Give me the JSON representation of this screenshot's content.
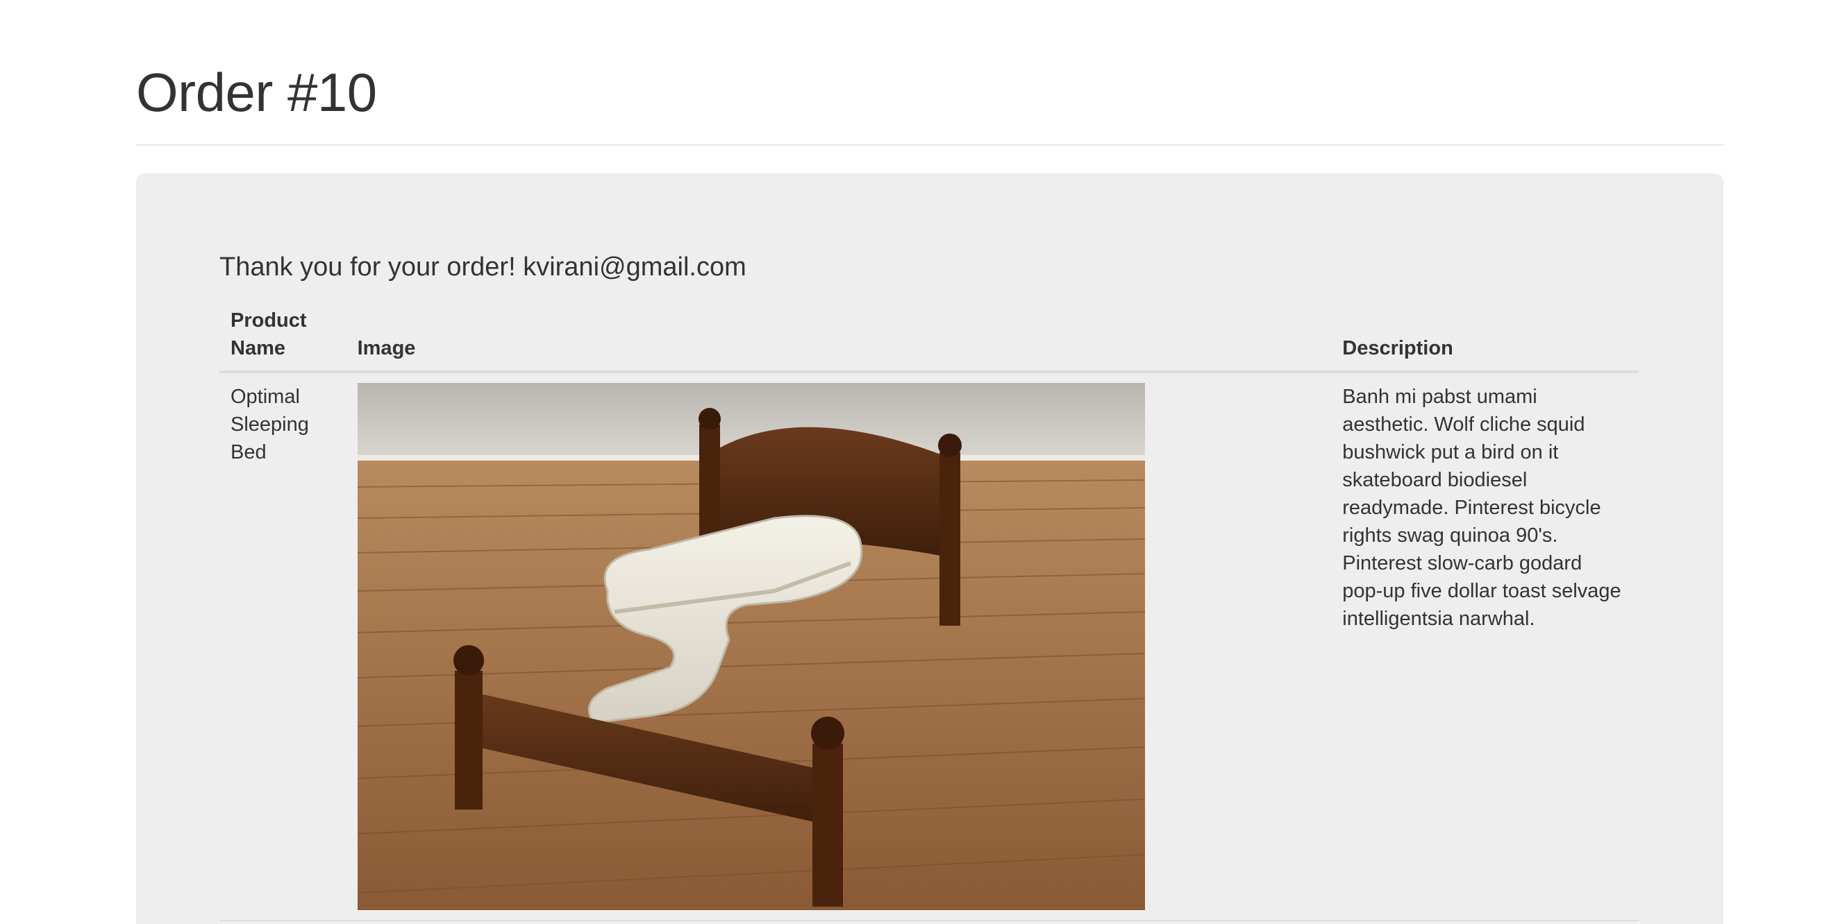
{
  "page": {
    "title": "Order #10"
  },
  "order": {
    "thanks_message": "Thank you for your order! kvirani@gmail.com",
    "table": {
      "headers": {
        "product_name": "Product Name",
        "image": "Image",
        "description": "Description"
      },
      "rows": [
        {
          "product_name": "Optimal Sleeping Bed",
          "image_alt": "photo of a wooden bed frame with a zig-zag shaped white mattress on a hardwood floor",
          "description": "Banh mi pabst umami aesthetic. Wolf cliche squid bushwick put a bird on it skateboard biodiesel readymade. Pinterest bicycle rights swag quinoa 90's. Pinterest slow-carb godard pop-up five dollar toast selvage intelligentsia narwhal."
        }
      ]
    }
  },
  "colors": {
    "text": "#333333",
    "panel_background": "#eeeeee",
    "rule": "#dddddd"
  }
}
